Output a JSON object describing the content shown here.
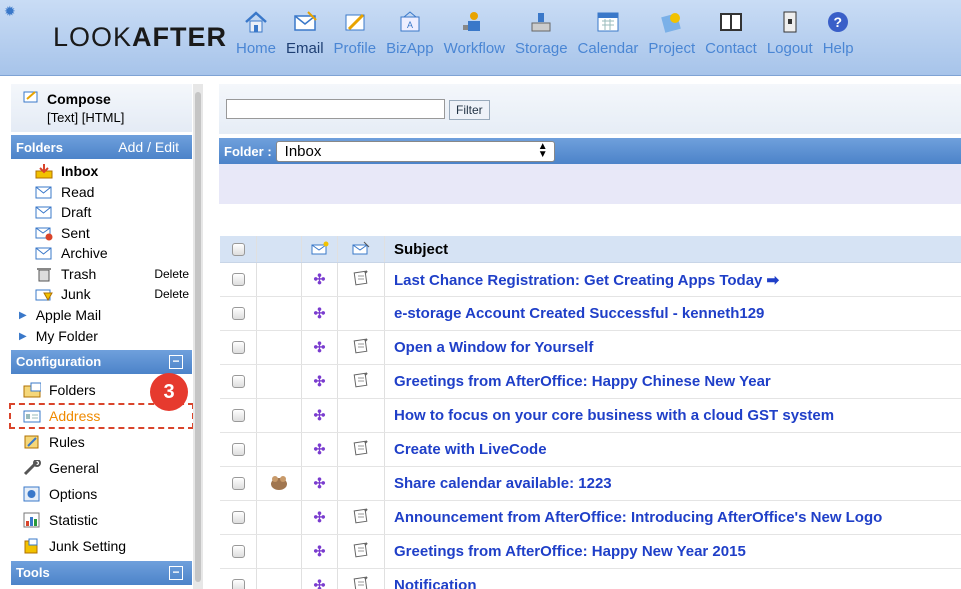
{
  "app": {
    "logo_light": "LOOK",
    "logo_bold": "AFTER"
  },
  "nav": [
    {
      "label": "Home",
      "icon": "home-icon"
    },
    {
      "label": "Email",
      "icon": "email-icon",
      "active": true
    },
    {
      "label": "Profile",
      "icon": "profile-icon"
    },
    {
      "label": "BizApp",
      "icon": "bizapp-icon"
    },
    {
      "label": "Workflow",
      "icon": "workflow-icon"
    },
    {
      "label": "Storage",
      "icon": "storage-icon"
    },
    {
      "label": "Calendar",
      "icon": "calendar-icon"
    },
    {
      "label": "Project",
      "icon": "project-icon"
    },
    {
      "label": "Contact",
      "icon": "contact-icon"
    },
    {
      "label": "Logout",
      "icon": "logout-icon"
    },
    {
      "label": "Help",
      "icon": "help-icon"
    }
  ],
  "sidebar": {
    "compose": {
      "title": "Compose",
      "text_link": "[Text]",
      "html_link": "[HTML]"
    },
    "folders_header": "Folders",
    "folders_action": "Add / Edit",
    "folders": [
      {
        "label": "Inbox",
        "bold": true,
        "icon": "inbox-icon"
      },
      {
        "label": "Read",
        "icon": "read-icon"
      },
      {
        "label": "Draft",
        "icon": "draft-icon"
      },
      {
        "label": "Sent",
        "icon": "sent-icon"
      },
      {
        "label": "Archive",
        "icon": "archive-icon"
      },
      {
        "label": "Trash",
        "icon": "trash-icon",
        "action": "Delete"
      },
      {
        "label": "Junk",
        "icon": "junk-icon",
        "action": "Delete"
      }
    ],
    "tree": [
      {
        "label": "Apple Mail"
      },
      {
        "label": "My Folder"
      }
    ],
    "config_header": "Configuration",
    "config": [
      {
        "label": "Folders",
        "icon": "folders-config-icon"
      },
      {
        "label": "Address",
        "icon": "address-icon",
        "selected": true
      },
      {
        "label": "Rules",
        "icon": "rules-icon"
      },
      {
        "label": "General",
        "icon": "general-icon"
      },
      {
        "label": "Options",
        "icon": "options-icon"
      },
      {
        "label": "Statistic",
        "icon": "statistic-icon"
      },
      {
        "label": "Junk Setting",
        "icon": "junk-setting-icon"
      }
    ],
    "tools_header": "Tools",
    "step_badge": "3"
  },
  "main": {
    "filter_value": "",
    "filter_button": "Filter",
    "folder_label": "Folder :",
    "folder_selected": "Inbox",
    "subject_header": "Subject",
    "messages": [
      {
        "subject": "Last Chance Registration: Get Creating Apps Today ➡",
        "attach": true,
        "avatar": false
      },
      {
        "subject": "e-storage Account Created Successful - kenneth129",
        "attach": false,
        "avatar": false
      },
      {
        "subject": "Open a Window for Yourself",
        "attach": true,
        "avatar": false
      },
      {
        "subject": "Greetings from AfterOffice: Happy Chinese New Year",
        "attach": true,
        "avatar": false
      },
      {
        "subject": "How to focus on your core business with a cloud GST system",
        "attach": false,
        "avatar": false
      },
      {
        "subject": "Create with LiveCode",
        "attach": true,
        "avatar": false
      },
      {
        "subject": "Share calendar available: 1223",
        "attach": false,
        "avatar": true
      },
      {
        "subject": "Announcement from AfterOffice: Introducing AfterOffice's New Logo",
        "attach": true,
        "avatar": false
      },
      {
        "subject": "Greetings from AfterOffice: Happy New Year 2015",
        "attach": true,
        "avatar": false
      },
      {
        "subject": "Notification",
        "attach": true,
        "avatar": false
      }
    ]
  },
  "colors": {
    "accent_blue": "#4c83c9",
    "link_blue": "#1f3fc8",
    "selected_orange": "#f08a00",
    "badge_red": "#e63a2e"
  }
}
